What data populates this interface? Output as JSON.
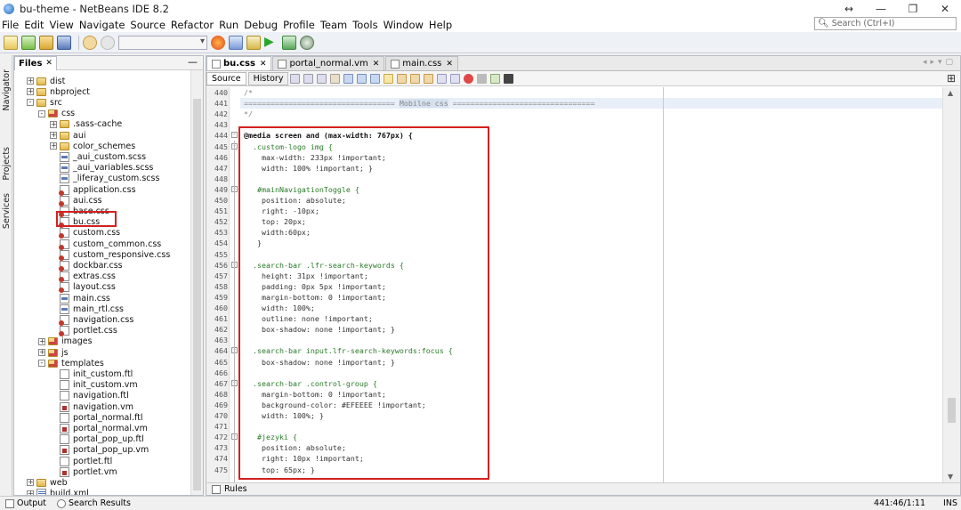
{
  "window": {
    "title": "bu-theme - NetBeans IDE 8.2",
    "buttons": [
      "↔",
      "—",
      "❐",
      "✕"
    ]
  },
  "menu": [
    "File",
    "Edit",
    "View",
    "Navigate",
    "Source",
    "Refactor",
    "Run",
    "Debug",
    "Profile",
    "Team",
    "Tools",
    "Window",
    "Help"
  ],
  "search": {
    "placeholder": "Search (Ctrl+I)"
  },
  "side_tabs": [
    "Navigator",
    "Projects",
    "Services"
  ],
  "files_panel": {
    "tab_label": "Files",
    "tree": [
      {
        "label": "dist",
        "icon": "folder",
        "level": 1,
        "expander": "+"
      },
      {
        "label": "nbproject",
        "icon": "folder",
        "level": 1,
        "expander": "+"
      },
      {
        "label": "src",
        "icon": "folder",
        "level": 1,
        "expander": "-"
      },
      {
        "label": "css",
        "icon": "pkg",
        "level": 2,
        "expander": "-"
      },
      {
        "label": ".sass-cache",
        "icon": "folder",
        "level": 3,
        "expander": "+"
      },
      {
        "label": "aui",
        "icon": "folder",
        "level": 3,
        "expander": "+"
      },
      {
        "label": "color_schemes",
        "icon": "folder",
        "level": 3,
        "expander": "+"
      },
      {
        "label": "_aui_custom.scss",
        "icon": "scss",
        "level": 3
      },
      {
        "label": "_aui_variables.scss",
        "icon": "scss",
        "level": 3
      },
      {
        "label": "_liferay_custom.scss",
        "icon": "scss",
        "level": 3
      },
      {
        "label": "application.css",
        "icon": "css",
        "level": 3
      },
      {
        "label": "aui.css",
        "icon": "css",
        "level": 3
      },
      {
        "label": "base.css",
        "icon": "css",
        "level": 3
      },
      {
        "label": "bu.css",
        "icon": "css",
        "level": 3
      },
      {
        "label": "custom.css",
        "icon": "css",
        "level": 3
      },
      {
        "label": "custom_common.css",
        "icon": "css",
        "level": 3
      },
      {
        "label": "custom_responsive.css",
        "icon": "css",
        "level": 3
      },
      {
        "label": "dockbar.css",
        "icon": "css",
        "level": 3
      },
      {
        "label": "extras.css",
        "icon": "css",
        "level": 3
      },
      {
        "label": "layout.css",
        "icon": "css",
        "level": 3
      },
      {
        "label": "main.css",
        "icon": "scss",
        "level": 3
      },
      {
        "label": "main_rtl.css",
        "icon": "scss",
        "level": 3
      },
      {
        "label": "navigation.css",
        "icon": "css",
        "level": 3
      },
      {
        "label": "portlet.css",
        "icon": "css",
        "level": 3
      },
      {
        "label": "images",
        "icon": "pkg",
        "level": 2,
        "expander": "+"
      },
      {
        "label": "js",
        "icon": "pkg",
        "level": 2,
        "expander": "+"
      },
      {
        "label": "templates",
        "icon": "pkg",
        "level": 2,
        "expander": "-"
      },
      {
        "label": "init_custom.ftl",
        "icon": "doc",
        "level": 3
      },
      {
        "label": "init_custom.vm",
        "icon": "doc",
        "level": 3
      },
      {
        "label": "navigation.ftl",
        "icon": "doc",
        "level": 3
      },
      {
        "label": "navigation.vm",
        "icon": "vm",
        "level": 3
      },
      {
        "label": "portal_normal.ftl",
        "icon": "doc",
        "level": 3
      },
      {
        "label": "portal_normal.vm",
        "icon": "vm",
        "level": 3
      },
      {
        "label": "portal_pop_up.ftl",
        "icon": "doc",
        "level": 3
      },
      {
        "label": "portal_pop_up.vm",
        "icon": "vm",
        "level": 3
      },
      {
        "label": "portlet.ftl",
        "icon": "doc",
        "level": 3
      },
      {
        "label": "portlet.vm",
        "icon": "vm",
        "level": 3
      },
      {
        "label": "web",
        "icon": "folder",
        "level": 1,
        "expander": "+"
      },
      {
        "label": "build.xml",
        "icon": "xml",
        "level": 1,
        "expander": "+"
      }
    ]
  },
  "editor": {
    "tabs": [
      {
        "label": "bu.css",
        "active": true
      },
      {
        "label": "portal_normal.vm",
        "active": false
      },
      {
        "label": "main.css",
        "active": false
      }
    ],
    "modes": [
      "Source",
      "History"
    ],
    "lines": [
      {
        "n": "440",
        "t": "/*",
        "c": "comment"
      },
      {
        "n": "441",
        "t": "================================== Mobilne css ================================",
        "c": "comment"
      },
      {
        "n": "442",
        "t": "*/",
        "c": "comment"
      },
      {
        "n": "443",
        "t": "",
        "c": ""
      },
      {
        "n": "444",
        "t": "@media screen and (max-width: 767px) {",
        "c": "at"
      },
      {
        "n": "445",
        "t": "  .custom-logo img {",
        "c": "sel"
      },
      {
        "n": "446",
        "t": "    max-width: 233px !important;",
        "c": "prop"
      },
      {
        "n": "447",
        "t": "    width: 100% !important; }",
        "c": "prop"
      },
      {
        "n": "448",
        "t": "",
        "c": ""
      },
      {
        "n": "449",
        "t": "   #mainNavigationToggle {",
        "c": "sel"
      },
      {
        "n": "450",
        "t": "    position: absolute;",
        "c": "prop"
      },
      {
        "n": "451",
        "t": "    right: -10px;",
        "c": "prop"
      },
      {
        "n": "452",
        "t": "    top: 20px;",
        "c": "prop"
      },
      {
        "n": "453",
        "t": "    width:60px;",
        "c": "prop"
      },
      {
        "n": "454",
        "t": "   }",
        "c": "prop"
      },
      {
        "n": "455",
        "t": "",
        "c": ""
      },
      {
        "n": "456",
        "t": "  .search-bar .lfr-search-keywords {",
        "c": "sel"
      },
      {
        "n": "457",
        "t": "    height: 31px !important;",
        "c": "prop"
      },
      {
        "n": "458",
        "t": "    padding: 0px 5px !important;",
        "c": "prop"
      },
      {
        "n": "459",
        "t": "    margin-bottom: 0 !important;",
        "c": "prop"
      },
      {
        "n": "460",
        "t": "    width: 100%;",
        "c": "prop"
      },
      {
        "n": "461",
        "t": "    outline: none !important;",
        "c": "prop"
      },
      {
        "n": "462",
        "t": "    box-shadow: none !important; }",
        "c": "prop"
      },
      {
        "n": "463",
        "t": "",
        "c": ""
      },
      {
        "n": "464",
        "t": "  .search-bar input.lfr-search-keywords:focus {",
        "c": "sel"
      },
      {
        "n": "465",
        "t": "    box-shadow: none !important; }",
        "c": "prop"
      },
      {
        "n": "466",
        "t": "",
        "c": ""
      },
      {
        "n": "467",
        "t": "  .search-bar .control-group {",
        "c": "sel"
      },
      {
        "n": "468",
        "t": "    margin-bottom: 0 !important;",
        "c": "prop"
      },
      {
        "n": "469",
        "t": "    background-color: #EFEEEE !important;",
        "c": "prop"
      },
      {
        "n": "470",
        "t": "    width: 100%; }",
        "c": "prop"
      },
      {
        "n": "471",
        "t": "",
        "c": ""
      },
      {
        "n": "472",
        "t": "   #jezyki {",
        "c": "sel"
      },
      {
        "n": "473",
        "t": "    position: absolute;",
        "c": "prop"
      },
      {
        "n": "474",
        "t": "    right: 10px !important;",
        "c": "prop"
      },
      {
        "n": "475",
        "t": "    top: 65px; }",
        "c": "prop"
      }
    ],
    "rules_label": "Rules"
  },
  "statusbar": {
    "output_label": "Output",
    "search_results_label": "Search Results",
    "position": "441:46/1:11",
    "mode": "INS"
  },
  "colors": {
    "highlight_box": "#d32020",
    "selector": "#2a7a2a"
  }
}
